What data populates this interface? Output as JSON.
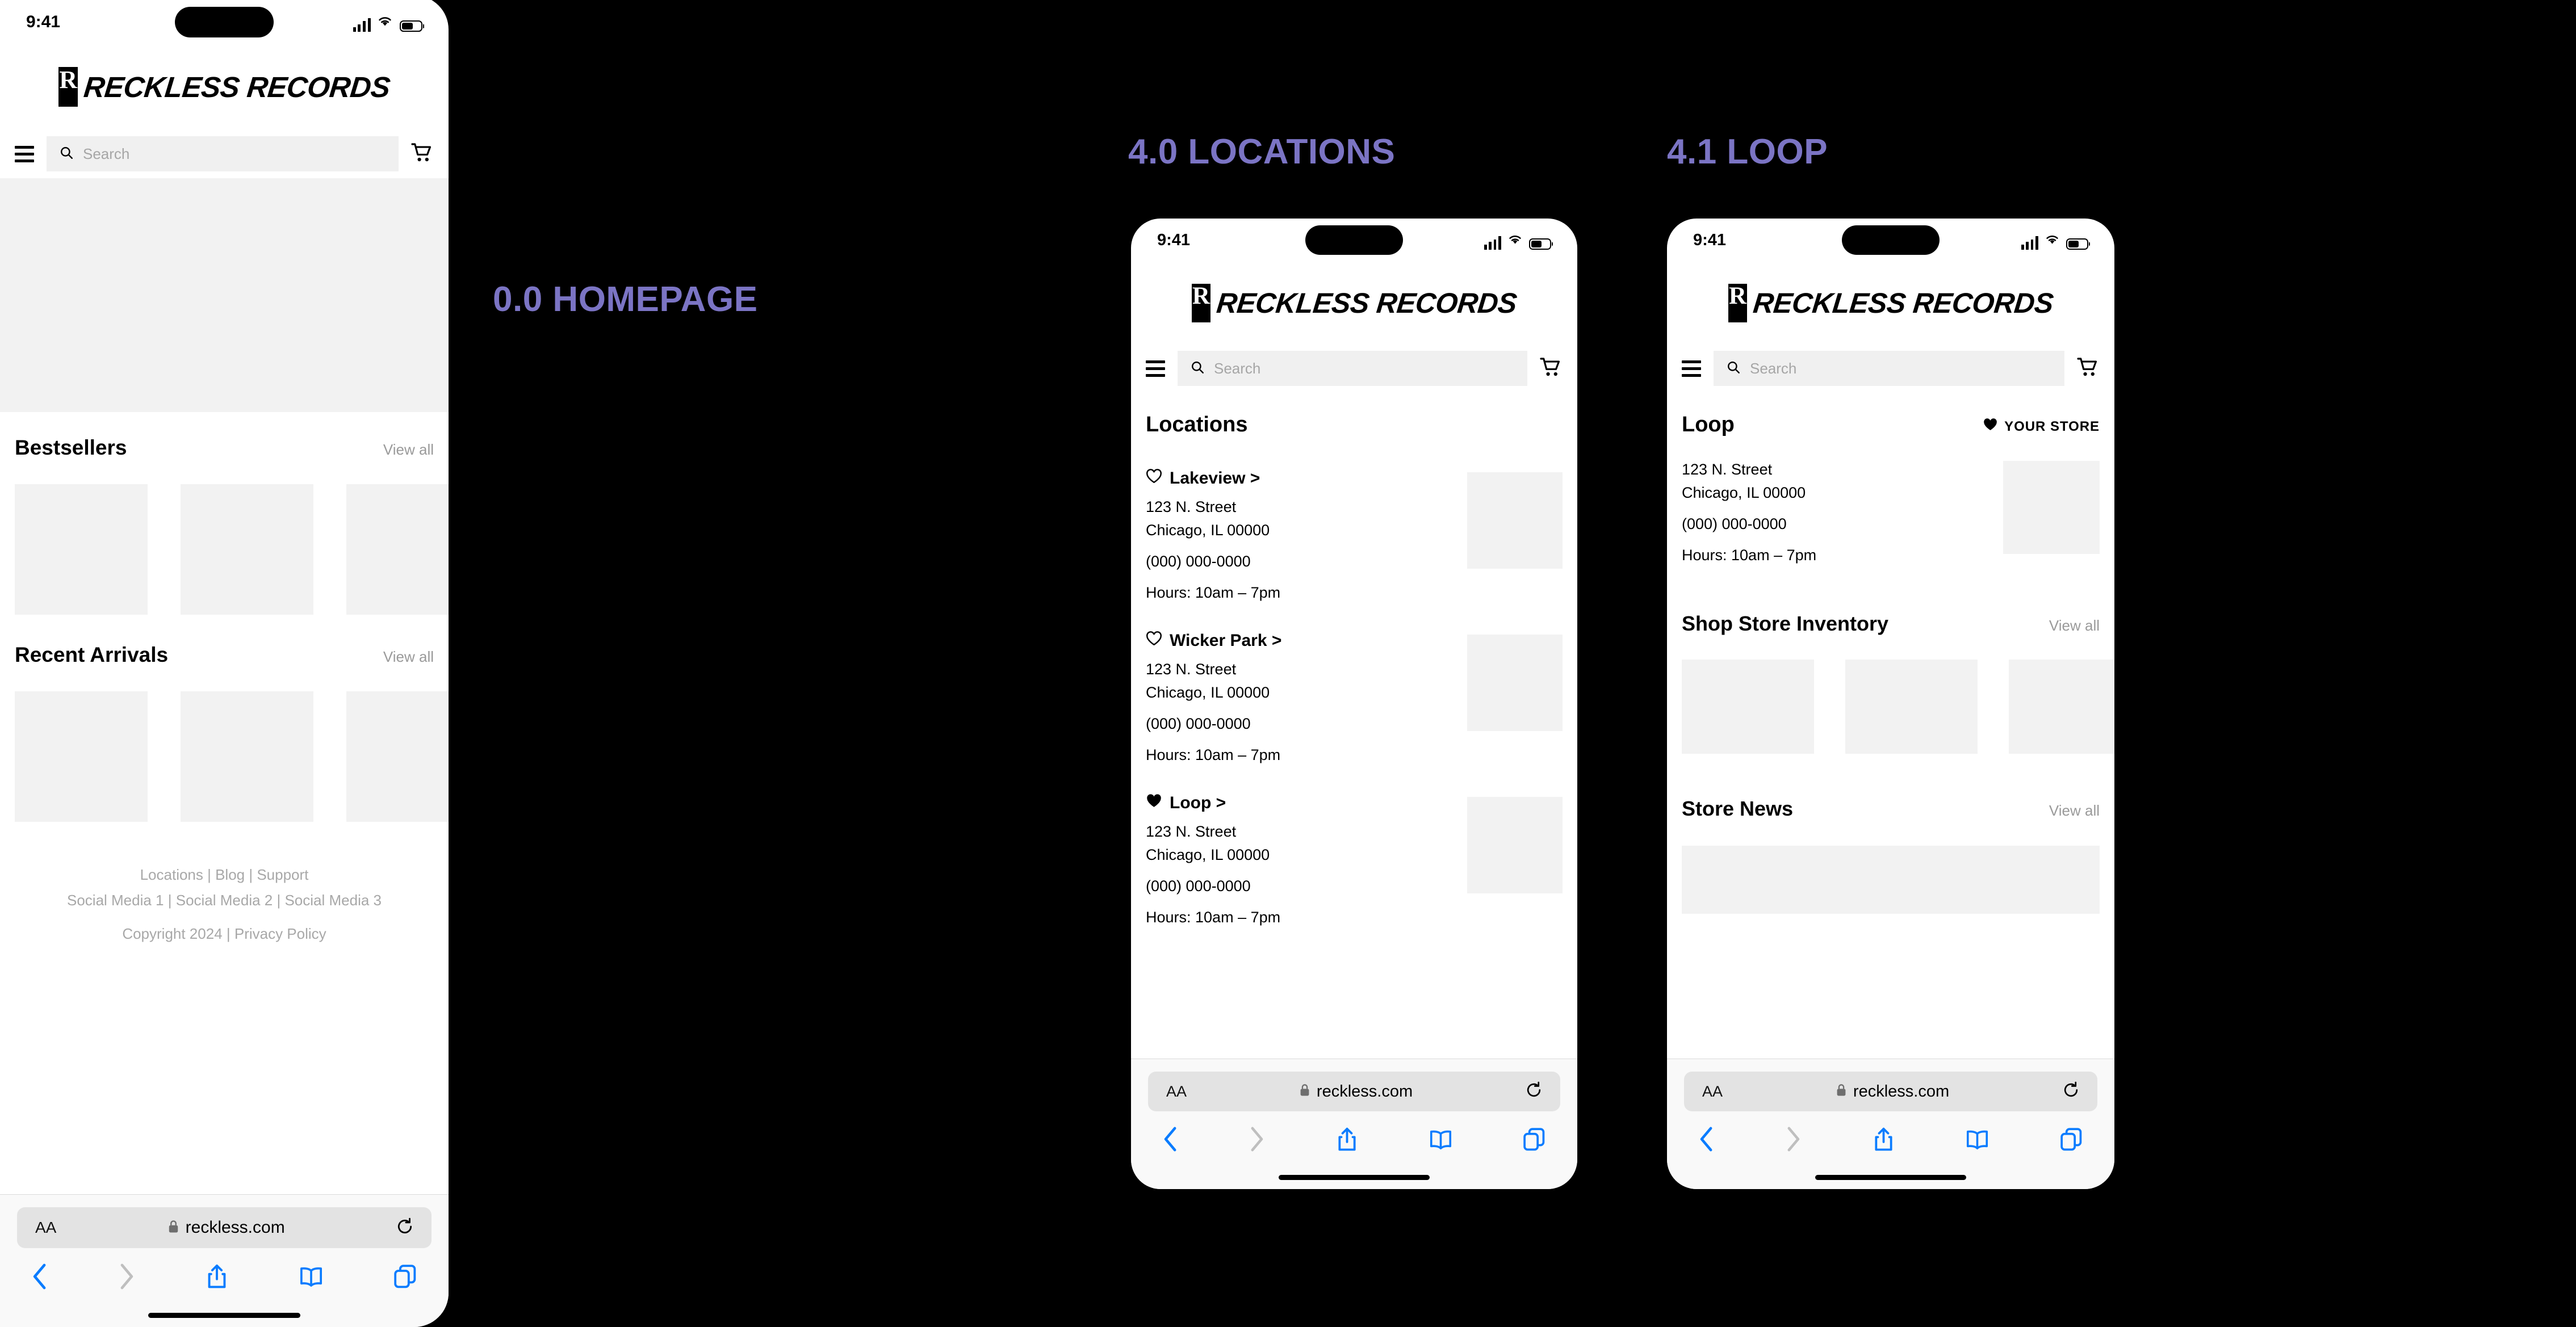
{
  "sections": {
    "homepage_label": "0.0 HOMEPAGE",
    "locations_label": "4.0 LOCATIONS",
    "loop_label": "4.1 LOOP",
    "accent_color": "#7B74C4"
  },
  "status_bar": {
    "time": "9:41",
    "cellular_icon": "signal-bars-icon",
    "wifi_icon": "wifi-icon",
    "battery_icon": "battery-icon"
  },
  "brand": {
    "badge_letter": "R",
    "wordmark": "RECKLESS RECORDS"
  },
  "nav": {
    "menu_icon": "hamburger-menu-icon",
    "search_icon": "search-icon",
    "search_placeholder": "Search",
    "search_value": "",
    "cart_icon": "shopping-cart-icon"
  },
  "homepage": {
    "sections": [
      {
        "title": "Bestsellers",
        "view_all": "View all",
        "tiles": 3
      },
      {
        "title": "Recent Arrivals",
        "view_all": "View all",
        "tiles": 3
      }
    ],
    "footer": {
      "line1": "Locations | Blog | Support",
      "line2": "Social Media 1 | Social Media 2 | Social Media 3",
      "line3": "Copyright 2024 | Privacy Policy"
    }
  },
  "locations_page": {
    "title": "Locations",
    "stores": [
      {
        "heart": "heart-outline-icon",
        "favorited": false,
        "name": "Lakeview >",
        "street": "123 N. Street",
        "city": "Chicago, IL 00000",
        "phone": "(000) 000-0000",
        "hours": "Hours: 10am – 7pm"
      },
      {
        "heart": "heart-outline-icon",
        "favorited": false,
        "name": "Wicker Park >",
        "street": "123 N. Street",
        "city": "Chicago, IL 00000",
        "phone": "(000) 000-0000",
        "hours": "Hours: 10am – 7pm"
      },
      {
        "heart": "heart-filled-icon",
        "favorited": true,
        "name": "Loop >",
        "street": "123 N. Street",
        "city": "Chicago, IL 00000",
        "phone": "(000) 000-0000",
        "hours": "Hours: 10am – 7pm"
      }
    ]
  },
  "loop_page": {
    "title": "Loop",
    "your_store_label": "YOUR STORE",
    "your_store_icon": "heart-filled-icon",
    "street": "123 N. Street",
    "city": "Chicago, IL 00000",
    "phone": "(000) 000-0000",
    "hours": "Hours: 10am – 7pm",
    "sections": [
      {
        "title": "Shop Store Inventory",
        "view_all": "View all",
        "tiles": 3
      },
      {
        "title": "Store News",
        "view_all": "View all",
        "tiles": 1
      }
    ]
  },
  "safari": {
    "text_size_label": "AA",
    "lock_icon": "lock-icon",
    "url": "reckless.com",
    "reload_icon": "reload-icon",
    "back_icon": "chevron-left-icon",
    "forward_icon": "chevron-right-icon",
    "share_icon": "share-icon",
    "bookmarks_icon": "book-icon",
    "tabs_icon": "tabs-icon"
  }
}
